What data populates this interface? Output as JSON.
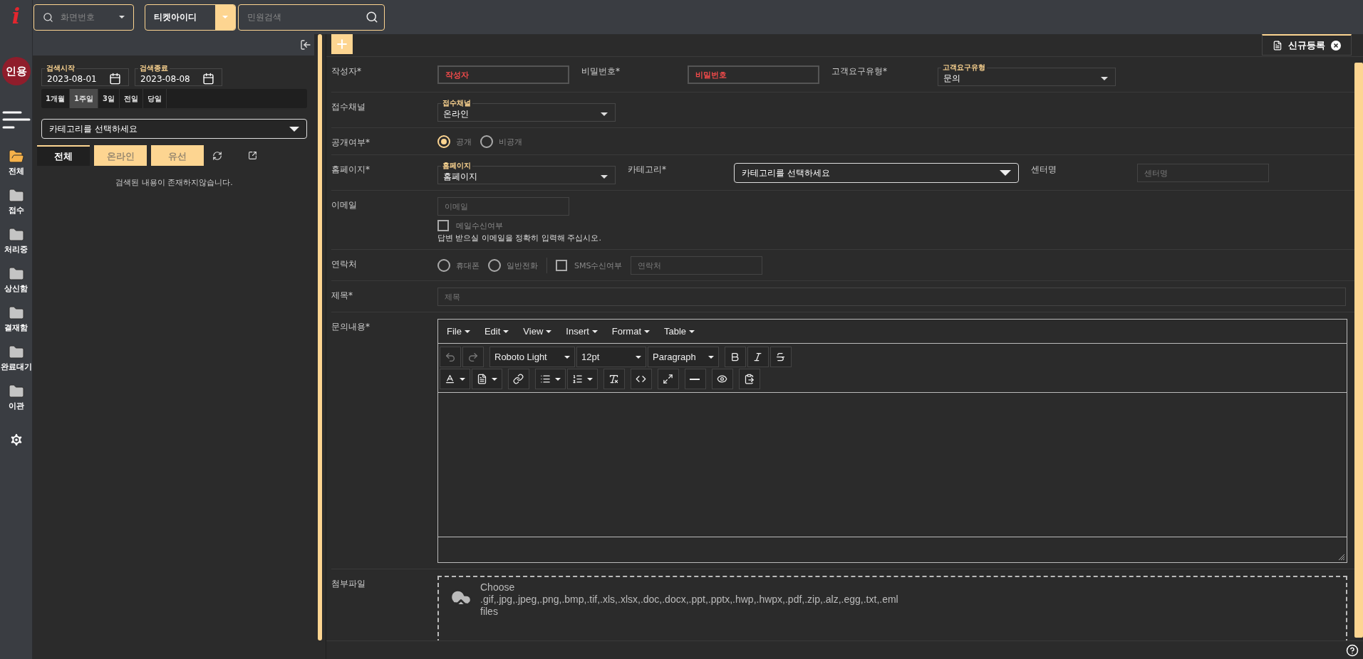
{
  "logo": "i",
  "user_avatar": "인용",
  "nav": [
    {
      "label": "전체",
      "selected": true
    },
    {
      "label": "접수",
      "selected": false
    },
    {
      "label": "처리중",
      "selected": false
    },
    {
      "label": "상신함",
      "selected": false
    },
    {
      "label": "결재함",
      "selected": false
    },
    {
      "label": "완료대기",
      "selected": false
    },
    {
      "label": "이관",
      "selected": false
    }
  ],
  "topbar": {
    "screen_search": {
      "placeholder": "화면번호"
    },
    "search_type": {
      "value": "티켓아이디"
    },
    "complaint_search": {
      "placeholder": "민원검색"
    }
  },
  "left_panel": {
    "date_start": {
      "caption": "검색시작",
      "value": "2023-08-01"
    },
    "date_end": {
      "caption": "검색종료",
      "value": "2023-08-08"
    },
    "periods": [
      {
        "label": "1개월",
        "selected": false
      },
      {
        "label": "1주일",
        "selected": true
      },
      {
        "label": "3일",
        "selected": false
      },
      {
        "label": "전일",
        "selected": false
      },
      {
        "label": "당일",
        "selected": false
      }
    ],
    "category_select": {
      "value": "카테고리를 선택하세요"
    },
    "channel_tabs": [
      {
        "label": "전체",
        "selected": true
      },
      {
        "label": "온라인",
        "selected": false
      },
      {
        "label": "유선",
        "selected": false
      }
    ],
    "empty_message": "검색된 내용이 존재하지않습니다."
  },
  "main": {
    "tabs": [
      {
        "label": "신규등록",
        "selected": true
      }
    ],
    "form": {
      "rows": [
        {
          "fields": [
            {
              "label": "작성자*",
              "controls": [
                {
                  "kind": "input",
                  "placeholder": "작성자",
                  "invalid": true
                }
              ]
            },
            {
              "label": "비밀번호*",
              "controls": [
                {
                  "kind": "input",
                  "placeholder": "비밀번호",
                  "invalid": true
                }
              ]
            },
            {
              "label": "고객요구유형*",
              "controls": [
                {
                  "kind": "floating_select",
                  "caption": "고객요구유형",
                  "value": "문의"
                }
              ]
            }
          ]
        },
        {
          "fields": [
            {
              "label": "접수채널",
              "controls": [
                {
                  "kind": "floating_select",
                  "caption": "접수채널",
                  "value": "온라인"
                }
              ]
            }
          ]
        },
        {
          "fields": [
            {
              "label": "공개여부*",
              "controls": [
                {
                  "kind": "radio",
                  "label": "공개",
                  "selected": true
                },
                {
                  "kind": "radio",
                  "label": "비공개",
                  "selected": false
                }
              ]
            }
          ]
        },
        {
          "fields": [
            {
              "label": "홈페이지*",
              "controls": [
                {
                  "kind": "floating_select",
                  "caption": "홈페이지",
                  "value": "홈페이지"
                }
              ]
            },
            {
              "label": "카테고리*",
              "controls": [
                {
                  "kind": "select",
                  "value": "카테고리를 선택하세요"
                }
              ]
            },
            {
              "label": "센터명",
              "controls": [
                {
                  "kind": "input",
                  "placeholder": "센터명",
                  "invalid": false
                }
              ]
            }
          ]
        },
        {
          "fields": [
            {
              "label": "이메일",
              "controls": [
                {
                  "kind": "input",
                  "placeholder": "이메일",
                  "invalid": false
                },
                {
                  "kind": "checkbox",
                  "label": "메일수신여부",
                  "checked": false
                },
                {
                  "kind": "hint",
                  "text": "답변 받으실 이메일을 정확히 입력해 주십시오."
                }
              ]
            }
          ]
        },
        {
          "fields": [
            {
              "label": "연락처",
              "controls": [
                {
                  "kind": "radio",
                  "label": "휴대폰",
                  "selected": false
                },
                {
                  "kind": "radio",
                  "label": "일반전화",
                  "selected": false
                },
                {
                  "kind": "divider"
                },
                {
                  "kind": "checkbox",
                  "label": "SMS수신여부",
                  "checked": false
                },
                {
                  "kind": "input",
                  "placeholder": "연락처",
                  "invalid": false
                }
              ]
            }
          ]
        },
        {
          "fields": [
            {
              "label": "제목*",
              "controls": [
                {
                  "kind": "title_input",
                  "placeholder": "제목"
                }
              ]
            }
          ]
        },
        {
          "fields": [
            {
              "label": "문의내용*",
              "controls": [
                {
                  "kind": "editor",
                  "menus": [
                    "File",
                    "Edit",
                    "View",
                    "Insert",
                    "Format",
                    "Table"
                  ],
                  "dropdowns": [
                    "Roboto Light",
                    "12pt",
                    "Paragraph"
                  ],
                  "history_disabled": true
                }
              ]
            }
          ]
        },
        {
          "fields": [
            {
              "label": "첨부파일",
              "controls": [
                {
                  "kind": "upload",
                  "lines": [
                    "Choose",
                    ".gif,.jpg,.jpeg,.png,.bmp,.tif,.xls,.xlsx,.doc,.docx,.ppt,.pptx,.hwp,.hwpx,.pdf,.zip,.alz,.egg,.txt,.eml",
                    "files"
                  ]
                }
              ]
            }
          ]
        }
      ]
    }
  }
}
